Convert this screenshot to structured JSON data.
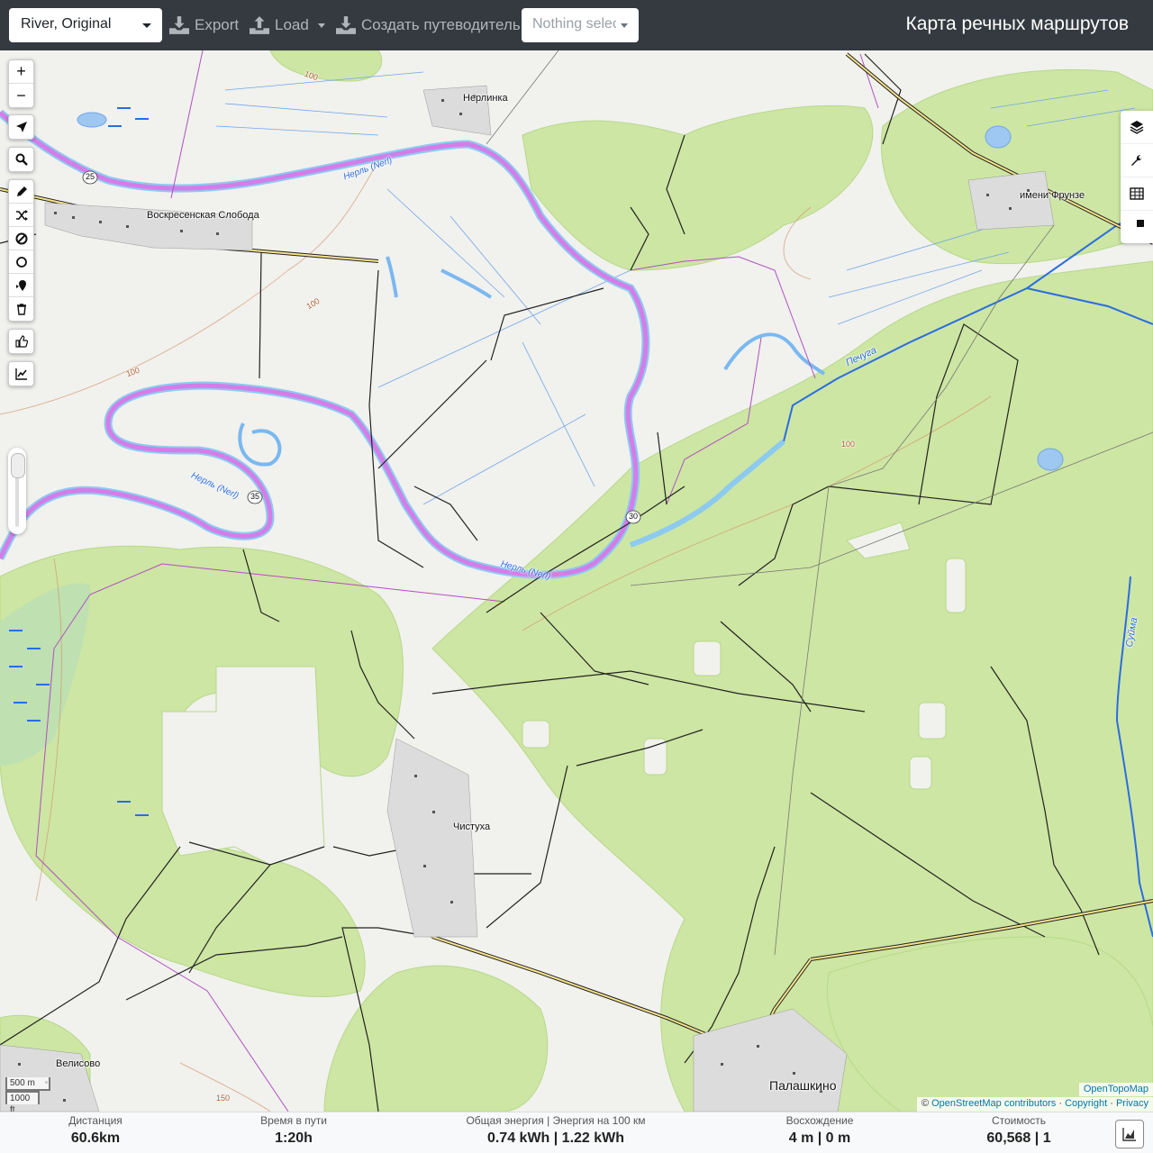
{
  "header": {
    "profile": "River, Original",
    "export_label": "Export",
    "load_label": "Load",
    "guide_label": "Создать путеводитель",
    "selection_placeholder": "Nothing selected",
    "title": "Карта речных маршрутов"
  },
  "map": {
    "labels": [
      "Нерлинка",
      "Воскресенская Слобода",
      "имени Фрунзе",
      "Чистуха",
      "Велисово",
      "Палашкино",
      "Печуга",
      "Нерль (Nerl)",
      "Суйма"
    ],
    "road_refs": [
      "25",
      "35",
      "30"
    ],
    "contours": [
      "100",
      "150"
    ],
    "scale": {
      "metric": "500 m",
      "imperial": "1000 ft"
    },
    "attribution": {
      "tiles": "OpenTopoMap",
      "osm": "OpenStreetMap contributors",
      "copyright": "Copyright",
      "privacy": "Privacy"
    }
  },
  "left_controls": {
    "zoom_in": "+",
    "zoom_out": "−",
    "tools": [
      "locate-icon",
      "search-icon",
      "draw-icon",
      "shuffle-icon",
      "no-go-icon",
      "circle-icon",
      "poi-icon",
      "trash-icon",
      "thumbs-up-icon",
      "elevation-icon"
    ]
  },
  "right_controls": [
    "layers-icon",
    "wrench-icon",
    "table-icon",
    "pie-chart-icon"
  ],
  "stats": {
    "distance": {
      "label": "Дистанция",
      "value": "60.6",
      "unit": "km"
    },
    "time": {
      "label": "Время в пути",
      "value": "1:20",
      "unit": "h"
    },
    "energy": {
      "label": "Общая энергия | Энергия на 100 км",
      "value": "0.74 kWh | 1.22 kWh"
    },
    "ascent": {
      "label": "Восхождение",
      "value": "4 m | 0 m"
    },
    "cost": {
      "label": "Стоимость",
      "value": "60,568 | 1"
    }
  },
  "colors": {
    "topbar": "#343a40",
    "route": "#e070e8",
    "river": "#7ab8f0",
    "forest": "#c8e6a0"
  }
}
